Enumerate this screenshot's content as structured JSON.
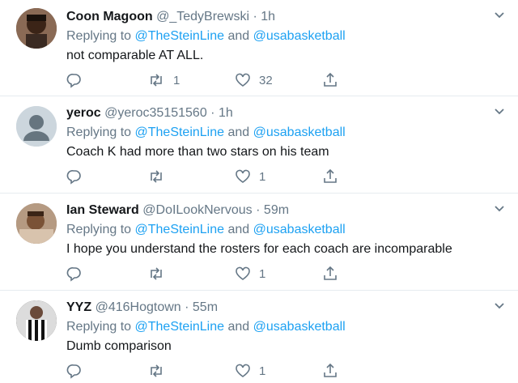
{
  "replying_prefix": "Replying to ",
  "tweets": [
    {
      "name": "Coon Magoon",
      "handle": "@_TedyBrewski",
      "time": "· 1h",
      "mentions": [
        "@TheSteinLine",
        "@usabasketball"
      ],
      "conjunction": " and ",
      "text": "not comparable AT ALL.",
      "retweets": "1",
      "likes": "32"
    },
    {
      "name": "yeroc",
      "handle": "@yeroc35151560",
      "time": "· 1h",
      "mentions": [
        "@TheSteinLine",
        "@usabasketball"
      ],
      "conjunction": " and ",
      "text": "Coach K had more than two stars on his team",
      "retweets": "",
      "likes": "1"
    },
    {
      "name": "Ian Steward",
      "handle": "@DoILookNervous",
      "time": "· 59m",
      "mentions": [
        "@TheSteinLine",
        "@usabasketball"
      ],
      "conjunction": " and ",
      "text": "I hope you understand the rosters for each coach are incomparable",
      "retweets": "",
      "likes": "1"
    },
    {
      "name": "YYZ",
      "handle": "@416Hogtown",
      "time": "· 55m",
      "mentions": [
        "@TheSteinLine",
        "@usabasketball"
      ],
      "conjunction": " and ",
      "text": "Dumb comparison",
      "retweets": "",
      "likes": "1"
    }
  ],
  "colors": {
    "name": "#14171a",
    "meta": "#657786",
    "link": "#1da1f2",
    "divider": "#e6ecf0"
  },
  "icons": {
    "reply": "reply-icon",
    "retweet": "retweet-icon",
    "like": "heart-icon",
    "share": "share-icon",
    "more": "chevron-down-icon"
  }
}
